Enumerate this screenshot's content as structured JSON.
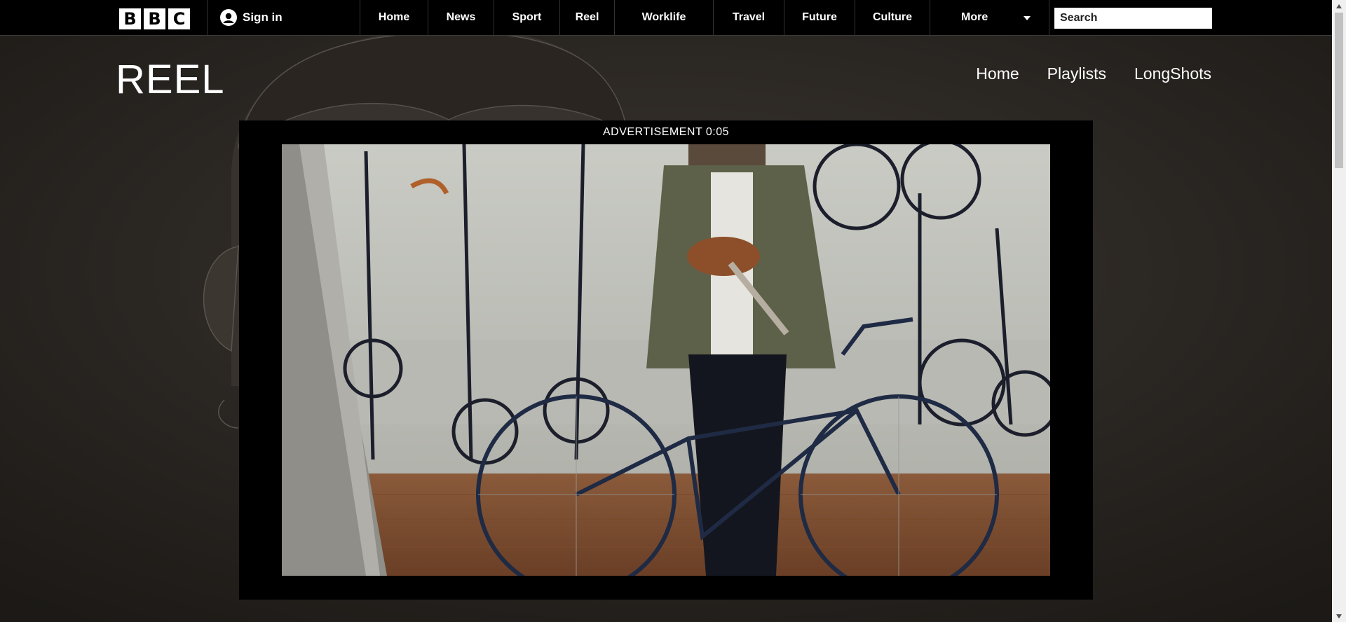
{
  "topbar": {
    "logo_letters": [
      "B",
      "B",
      "C"
    ],
    "signin_label": "Sign in",
    "nav": [
      "Home",
      "News",
      "Sport",
      "Reel",
      "Worklife",
      "Travel",
      "Future",
      "Culture",
      "More"
    ],
    "search_placeholder": "Search"
  },
  "reel": {
    "title": "REEL",
    "nav": [
      "Home",
      "Playlists",
      "LongShots"
    ]
  },
  "player": {
    "ad_label": "ADVERTISEMENT 0:05"
  },
  "colors": {
    "topbar_bg": "#000000",
    "page_bg": "#2a2622",
    "player_bg": "#000000"
  },
  "icons": [
    "user-icon",
    "search-icon",
    "chevron-down-icon",
    "scroll-up-arrow-icon",
    "scroll-down-arrow-icon"
  ]
}
